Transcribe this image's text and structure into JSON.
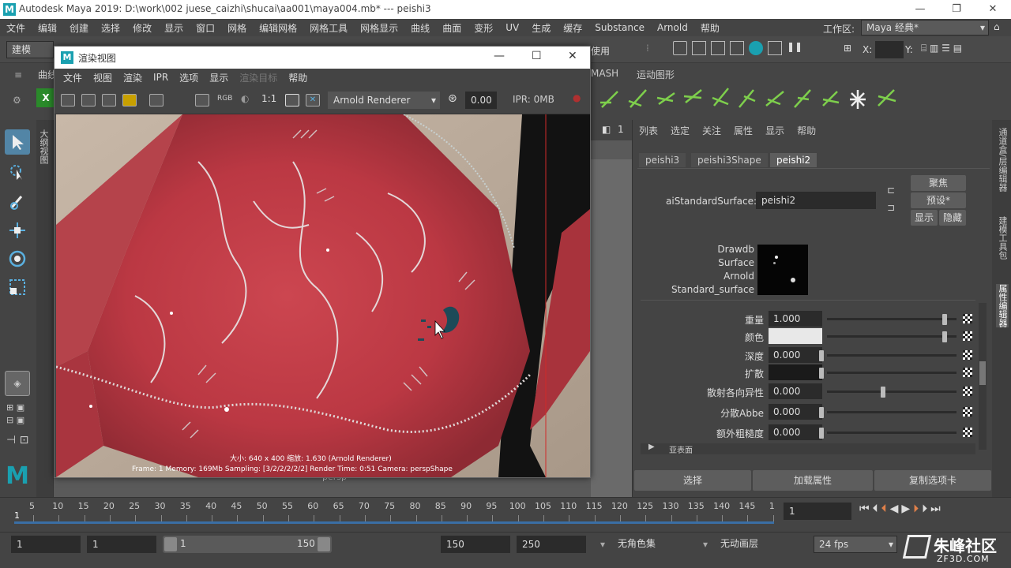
{
  "app": {
    "title": "Autodesk Maya 2019: D:\\work\\002 juese_caizhi\\shucai\\aa001\\maya004.mb*   ---   peishi3",
    "logo": "M",
    "window_controls": {
      "minimize": "—",
      "restore": "❐",
      "close": "✕"
    }
  },
  "menubar": [
    "文件",
    "编辑",
    "创建",
    "选择",
    "修改",
    "显示",
    "窗口",
    "网格",
    "编辑网格",
    "网格工具",
    "网格显示",
    "曲线",
    "曲面",
    "变形",
    "UV",
    "生成",
    "缓存",
    "Substance",
    "Arnold",
    "帮助"
  ],
  "workspace": {
    "label": "工作区:",
    "value": "Maya 经典*"
  },
  "statusline": {
    "mode": "建模",
    "apply_label": "使用",
    "x_label": "X:",
    "y_label": "Y:"
  },
  "shelf": {
    "tabs": [
      "曲线",
      "MASH",
      "运动图形"
    ]
  },
  "render_view": {
    "title": "渲染视图",
    "menu": [
      "文件",
      "视图",
      "渲染",
      "IPR",
      "选项",
      "显示",
      "渲染目标",
      "帮助"
    ],
    "ratio": "1:1",
    "rgb": "RGB",
    "renderer": "Arnold Renderer",
    "exposure": "0.00",
    "ipr_mem": "IPR: 0MB",
    "overlay_line1": "大小: 640 x 400 缩放: 1.630     (Arnold Renderer)",
    "overlay_line2": "Frame: 1     Memory: 169Mb     Sampling: [3/2/2/2/2/2]     Render Time: 0:51     Camera: perspShape"
  },
  "viewport": {
    "camera": "persp",
    "frame_hint": "1"
  },
  "left_strip_label": "大纲视图",
  "attribute_editor": {
    "menu": [
      "列表",
      "选定",
      "关注",
      "属性",
      "显示",
      "帮助"
    ],
    "tabs": [
      "peishi3",
      "peishi3Shape",
      "peishi2"
    ],
    "active_tab": "peishi2",
    "node_type_label": "aiStandardSurface:",
    "node_name": "peishi2",
    "buttons": {
      "focus": "聚焦",
      "presets": "预设*",
      "show": "显示",
      "hide": "隐藏"
    },
    "swatch_label": [
      "Drawdb",
      "Surface",
      "Arnold",
      "Standard_surface"
    ],
    "attributes": [
      {
        "label": "重量",
        "value": "1.000",
        "slider": 1.0
      },
      {
        "label": "颜色",
        "value": "",
        "slider": 1.0,
        "swatch": "#e8e8e8"
      },
      {
        "label": "深度",
        "value": "0.000",
        "slider": 0.0
      },
      {
        "label": "扩散",
        "value": "",
        "slider": 0.0,
        "swatch": "#1a1a1a"
      },
      {
        "label": "散射各向异性",
        "value": "0.000",
        "slider": 0.5
      },
      {
        "label": "分散Abbe",
        "value": "0.000",
        "slider": 0.0
      },
      {
        "label": "额外粗糙度",
        "value": "0.000",
        "slider": 0.0
      }
    ],
    "section_collapsed": "亚表面",
    "bottom_buttons": [
      "选择",
      "加载属性",
      "复制选项卡"
    ]
  },
  "right_sidebar": [
    "通道盒/层编辑器",
    "建模工具包",
    "属性编辑器"
  ],
  "timeline": {
    "ticks": [
      "5",
      "10",
      "15",
      "20",
      "25",
      "30",
      "35",
      "40",
      "45",
      "50",
      "55",
      "60",
      "65",
      "70",
      "75",
      "80",
      "85",
      "90",
      "95",
      "100",
      "105",
      "110",
      "115",
      "120",
      "125",
      "130",
      "135",
      "140",
      "145",
      "1"
    ],
    "start_marker": "1",
    "current_frame": "1"
  },
  "range": {
    "start": "1",
    "playback_start": "1",
    "slider_start": "1",
    "slider_end": "150",
    "playback_end": "150",
    "end": "250",
    "char_set": "无角色集",
    "anim_layer": "无动画层",
    "fps": "24 fps"
  },
  "watermark": {
    "text": "朱峰社区",
    "sub": "ZF3D.COM"
  },
  "colors": {
    "accent": "#1aa0b0",
    "fabric": "#c0343f",
    "timeline_blue": "#3a6ea5"
  }
}
